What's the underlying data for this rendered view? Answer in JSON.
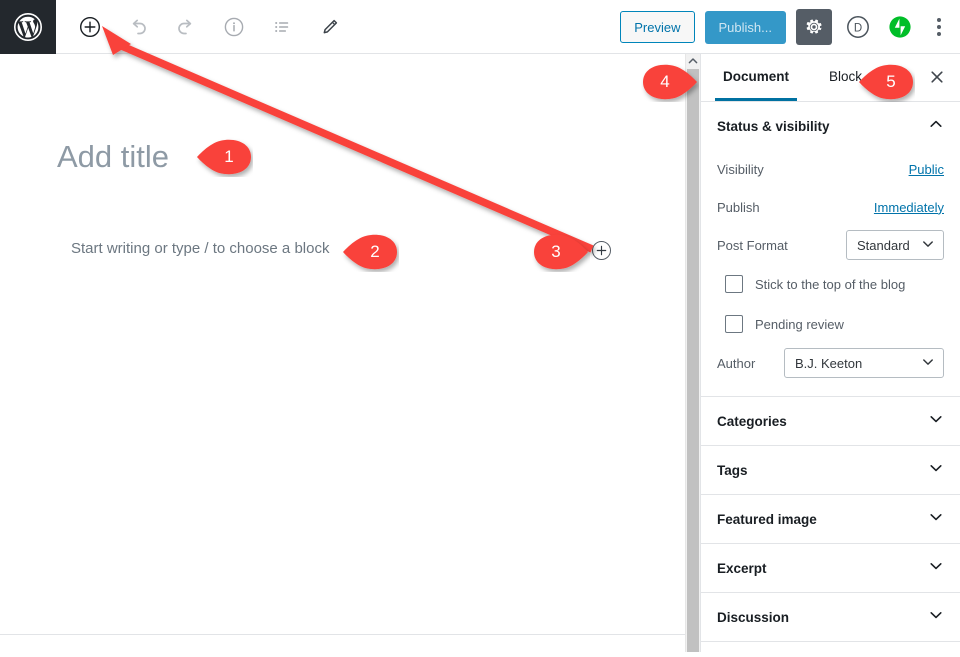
{
  "toolbar": {
    "logo_name": "WordPress",
    "icons": [
      {
        "name": "add-block-icon",
        "title": "Add block"
      },
      {
        "name": "undo-icon",
        "title": "Undo"
      },
      {
        "name": "redo-icon",
        "title": "Redo"
      },
      {
        "name": "info-icon",
        "title": "Content structure"
      },
      {
        "name": "list-view-icon",
        "title": "Block navigation"
      },
      {
        "name": "pencil-icon",
        "title": "Edit"
      }
    ],
    "preview_label": "Preview",
    "publish_label": "Publish...",
    "settings_icon": "gear-icon",
    "divi_icon_label": "D",
    "jetpack_icon": "jetpack-icon",
    "more_menu_icon": "kebab-menu-icon"
  },
  "editor": {
    "title_placeholder": "Add title",
    "block_placeholder": "Start writing or type / to choose a block",
    "inline_inserter_icon": "plus-circle-icon"
  },
  "sidebar": {
    "tabs": [
      {
        "label": "Document",
        "active": true
      },
      {
        "label": "Block",
        "active": false
      }
    ],
    "close_icon": "close-icon",
    "status_panel": {
      "title": "Status & visibility",
      "expanded": true,
      "chevron": "chevron-up-icon",
      "rows": [
        {
          "label": "Visibility",
          "value": "Public",
          "type": "link"
        },
        {
          "label": "Publish",
          "value": "Immediately",
          "type": "link"
        },
        {
          "label": "Post Format",
          "value": "Standard",
          "type": "select"
        }
      ],
      "checkboxes": [
        {
          "label": "Stick to the top of the blog",
          "checked": false
        },
        {
          "label": "Pending review",
          "checked": false
        }
      ],
      "author": {
        "label": "Author",
        "value": "B.J. Keeton"
      }
    },
    "panels": [
      {
        "title": "Categories",
        "chevron": "chevron-down-icon"
      },
      {
        "title": "Tags",
        "chevron": "chevron-down-icon"
      },
      {
        "title": "Featured image",
        "chevron": "chevron-down-icon"
      },
      {
        "title": "Excerpt",
        "chevron": "chevron-down-icon"
      },
      {
        "title": "Discussion",
        "chevron": "chevron-down-icon"
      }
    ]
  },
  "annotations": {
    "accent_color": "#f9423a",
    "markers": [
      {
        "number": "1",
        "points_to": "post-title"
      },
      {
        "number": "2",
        "points_to": "block-placeholder"
      },
      {
        "number": "3",
        "points_to": "inline-inserter"
      },
      {
        "number": "4",
        "points_to": "document-tab"
      },
      {
        "number": "5",
        "points_to": "block-tab"
      }
    ],
    "arrow": {
      "from": "inline-inserter",
      "to": "toolbar-add-block-button"
    }
  },
  "colors": {
    "wp_bar": "#23282d",
    "link": "#0073aa",
    "publish_bg": "#3498c8",
    "gear_bg": "#555d66",
    "jetpack_green": "#00be28",
    "annotation_red": "#f9423a"
  }
}
